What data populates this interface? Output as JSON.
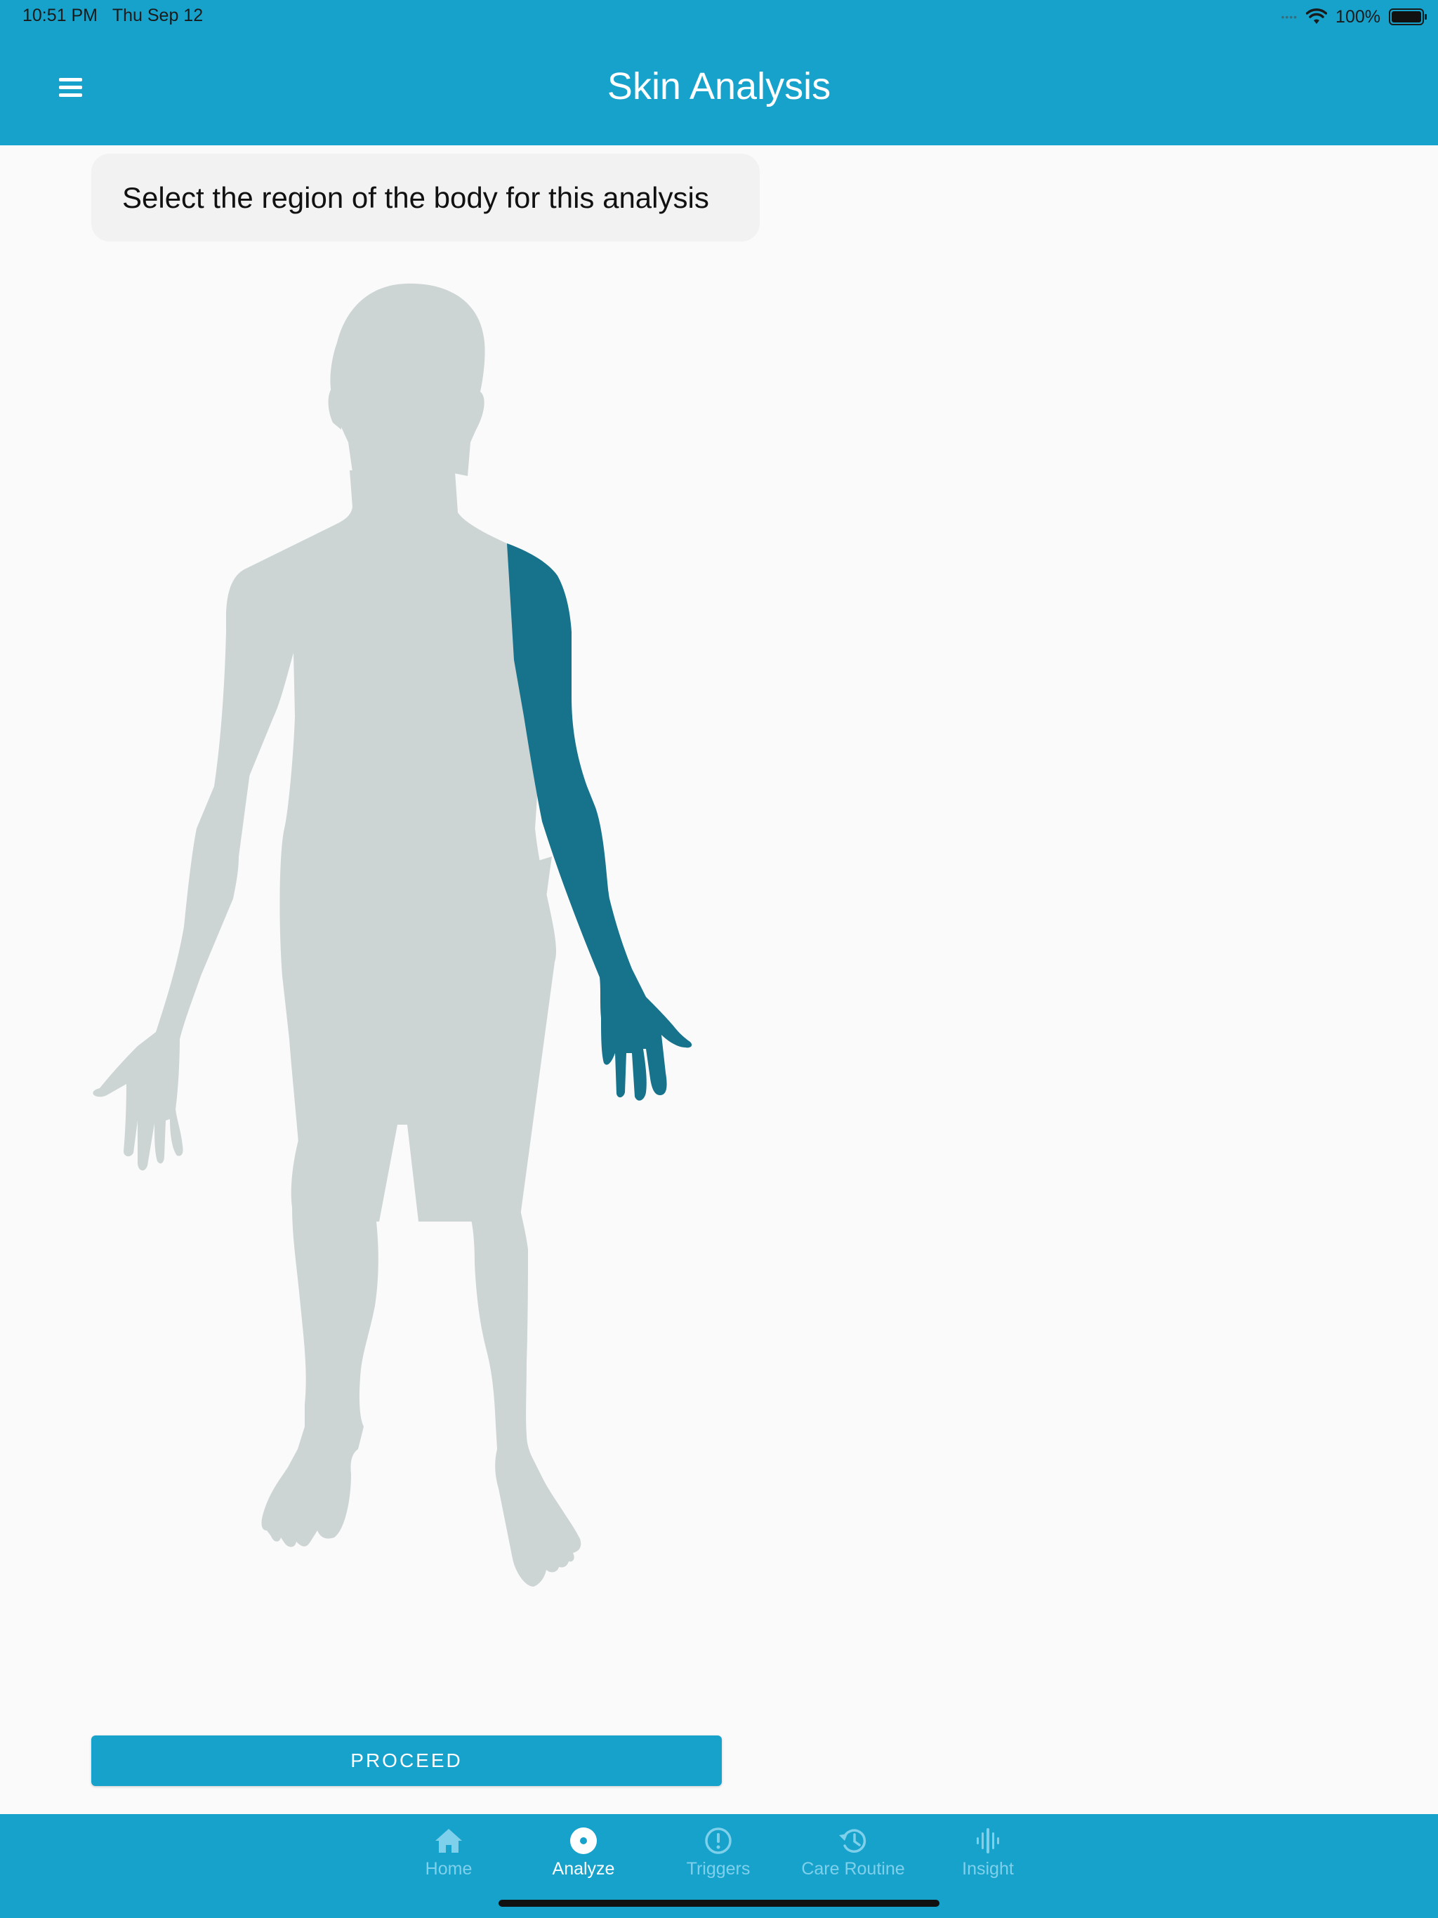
{
  "status": {
    "time": "10:51 PM",
    "date": "Thu Sep 12",
    "battery": "100%"
  },
  "header": {
    "title": "Skin Analysis",
    "menu_icon": "hamburger-icon"
  },
  "instruction": "Select the region of the body for this analysis",
  "body_map": {
    "selected_region": "left-arm",
    "base_color": "#ccd4d4",
    "highlight_color": "#17728c"
  },
  "proceed_label": "PROCEED",
  "tabs": [
    {
      "label": "Home",
      "icon": "home-icon",
      "active": false
    },
    {
      "label": "Analyze",
      "icon": "analyze-icon",
      "active": true
    },
    {
      "label": "Triggers",
      "icon": "triggers-icon",
      "active": false
    },
    {
      "label": "Care Routine",
      "icon": "care-routine-icon",
      "active": false
    },
    {
      "label": "Insight",
      "icon": "insight-icon",
      "active": false
    }
  ],
  "colors": {
    "brand": "#17a2cc",
    "tab_inactive": "#7fd0ea"
  }
}
